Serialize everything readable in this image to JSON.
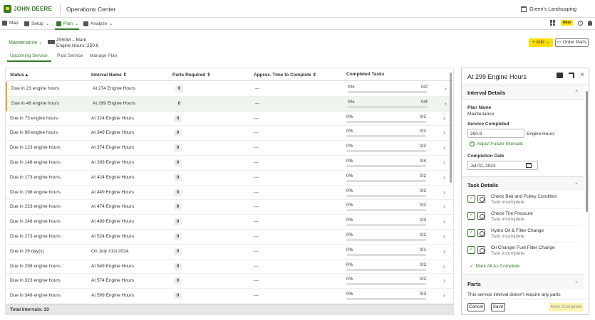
{
  "header": {
    "brand": "JOHN DEERE",
    "app_title": "Operations Center",
    "org_name": "Green's Landscaping"
  },
  "nav": {
    "items": [
      {
        "label": "Map",
        "icon": "map-icon"
      },
      {
        "label": "Setup",
        "icon": "setup-icon"
      },
      {
        "label": "Plan",
        "icon": "plan-icon"
      },
      {
        "label": "Analyze",
        "icon": "analyze-icon"
      }
    ],
    "new_badge": "New"
  },
  "breadcrumb": {
    "root": "Maintenance",
    "machine_name": "Z950M – Mark",
    "machine_hours": "Engine Hours: 250.9"
  },
  "actions": {
    "add_label": "+ Add",
    "order_parts_label": "Order Parts"
  },
  "tabs": [
    "Upcoming Service",
    "Past Service",
    "Manage Plan"
  ],
  "table": {
    "headers": [
      "Status",
      "Interval Name",
      "Parts Required",
      "Approx. Time to Complete",
      "Completed Tasks"
    ],
    "rows": [
      {
        "status": "Due in 23 engine hours",
        "interval": "At 274 Engine Hours",
        "parts": "0",
        "time": "---",
        "pct": "0%",
        "count": "0/2"
      },
      {
        "status": "Due in 48 engine hours",
        "interval": "At 299 Engine Hours",
        "parts": "0",
        "time": "---",
        "pct": "0%",
        "count": "0/4"
      },
      {
        "status": "Due in 73 engine hours",
        "interval": "At 324 Engine Hours",
        "parts": "0",
        "time": "---",
        "pct": "0%",
        "count": "0/2"
      },
      {
        "status": "Due in 98 engine hours",
        "interval": "At 349 Engine Hours",
        "parts": "0",
        "time": "---",
        "pct": "0%",
        "count": "0/2"
      },
      {
        "status": "Due in 123 engine hours",
        "interval": "At 374 Engine Hours",
        "parts": "0",
        "time": "---",
        "pct": "0%",
        "count": "0/2"
      },
      {
        "status": "Due in 148 engine hours",
        "interval": "At 399 Engine Hours",
        "parts": "0",
        "time": "---",
        "pct": "0%",
        "count": "0/4"
      },
      {
        "status": "Due in 173 engine hours",
        "interval": "At 424 Engine Hours",
        "parts": "0",
        "time": "---",
        "pct": "0%",
        "count": "0/2"
      },
      {
        "status": "Due in 198 engine hours",
        "interval": "At 449 Engine Hours",
        "parts": "0",
        "time": "---",
        "pct": "0%",
        "count": "0/2"
      },
      {
        "status": "Due in 223 engine hours",
        "interval": "At 474 Engine Hours",
        "parts": "0",
        "time": "---",
        "pct": "0%",
        "count": "0/2"
      },
      {
        "status": "Due in 248 engine hours",
        "interval": "At 499 Engine Hours",
        "parts": "0",
        "time": "---",
        "pct": "0%",
        "count": "0/3"
      },
      {
        "status": "Due in 273 engine hours",
        "interval": "At 524 Engine Hours",
        "parts": "0",
        "time": "---",
        "pct": "0%",
        "count": "0/2"
      },
      {
        "status": "Due in 29 day(s)",
        "interval": "On July 31st 2024",
        "parts": "0",
        "time": "---",
        "pct": "0%",
        "count": "0/1"
      },
      {
        "status": "Due in 298 engine hours",
        "interval": "At 549 Engine Hours",
        "parts": "0",
        "time": "---",
        "pct": "0%",
        "count": "0/3"
      },
      {
        "status": "Due in 323 engine hours",
        "interval": "At 574 Engine Hours",
        "parts": "0",
        "time": "---",
        "pct": "0%",
        "count": "0/2"
      },
      {
        "status": "Due in 348 engine hours",
        "interval": "At 599 Engine Hours",
        "parts": "0",
        "time": "---",
        "pct": "0%",
        "count": "0/3"
      }
    ],
    "footer": "Total Intervals: 33"
  },
  "panel": {
    "title": "At 299 Engine Hours",
    "interval_details_title": "Interval Details",
    "plan_name_label": "Plan Name",
    "plan_name_value": "Maintenance",
    "service_completed_label": "Service Completed",
    "service_completed_value": "250.9",
    "service_completed_suffix": "Engine Hours",
    "adjust_link": "Adjust Future Intervals",
    "completion_date_label": "Completion Date",
    "completion_date_value": "Jul 02, 2024",
    "task_details_title": "Task Details",
    "tasks": [
      {
        "name": "Check Belt and Pulley Condition",
        "status": "Task Incomplete"
      },
      {
        "name": "Check Tire Pressure",
        "status": "Task Incomplete"
      },
      {
        "name": "Hydro Oil & Filter Change",
        "status": "Task Incomplete"
      },
      {
        "name": "Oil Change/ Fuel Filter Change",
        "status": "Task Incomplete"
      }
    ],
    "mark_all_link": "Mark All As Complete",
    "parts_title": "Parts",
    "parts_text": "This service interval doesn't require any parts",
    "cancel_label": "Cancel",
    "save_label": "Save",
    "mark_complete_label": "Mark Complete"
  },
  "colors": {
    "brand_green": "#367c2b",
    "brand_yellow": "#ffde00",
    "warning_orange": "#f0a400"
  }
}
